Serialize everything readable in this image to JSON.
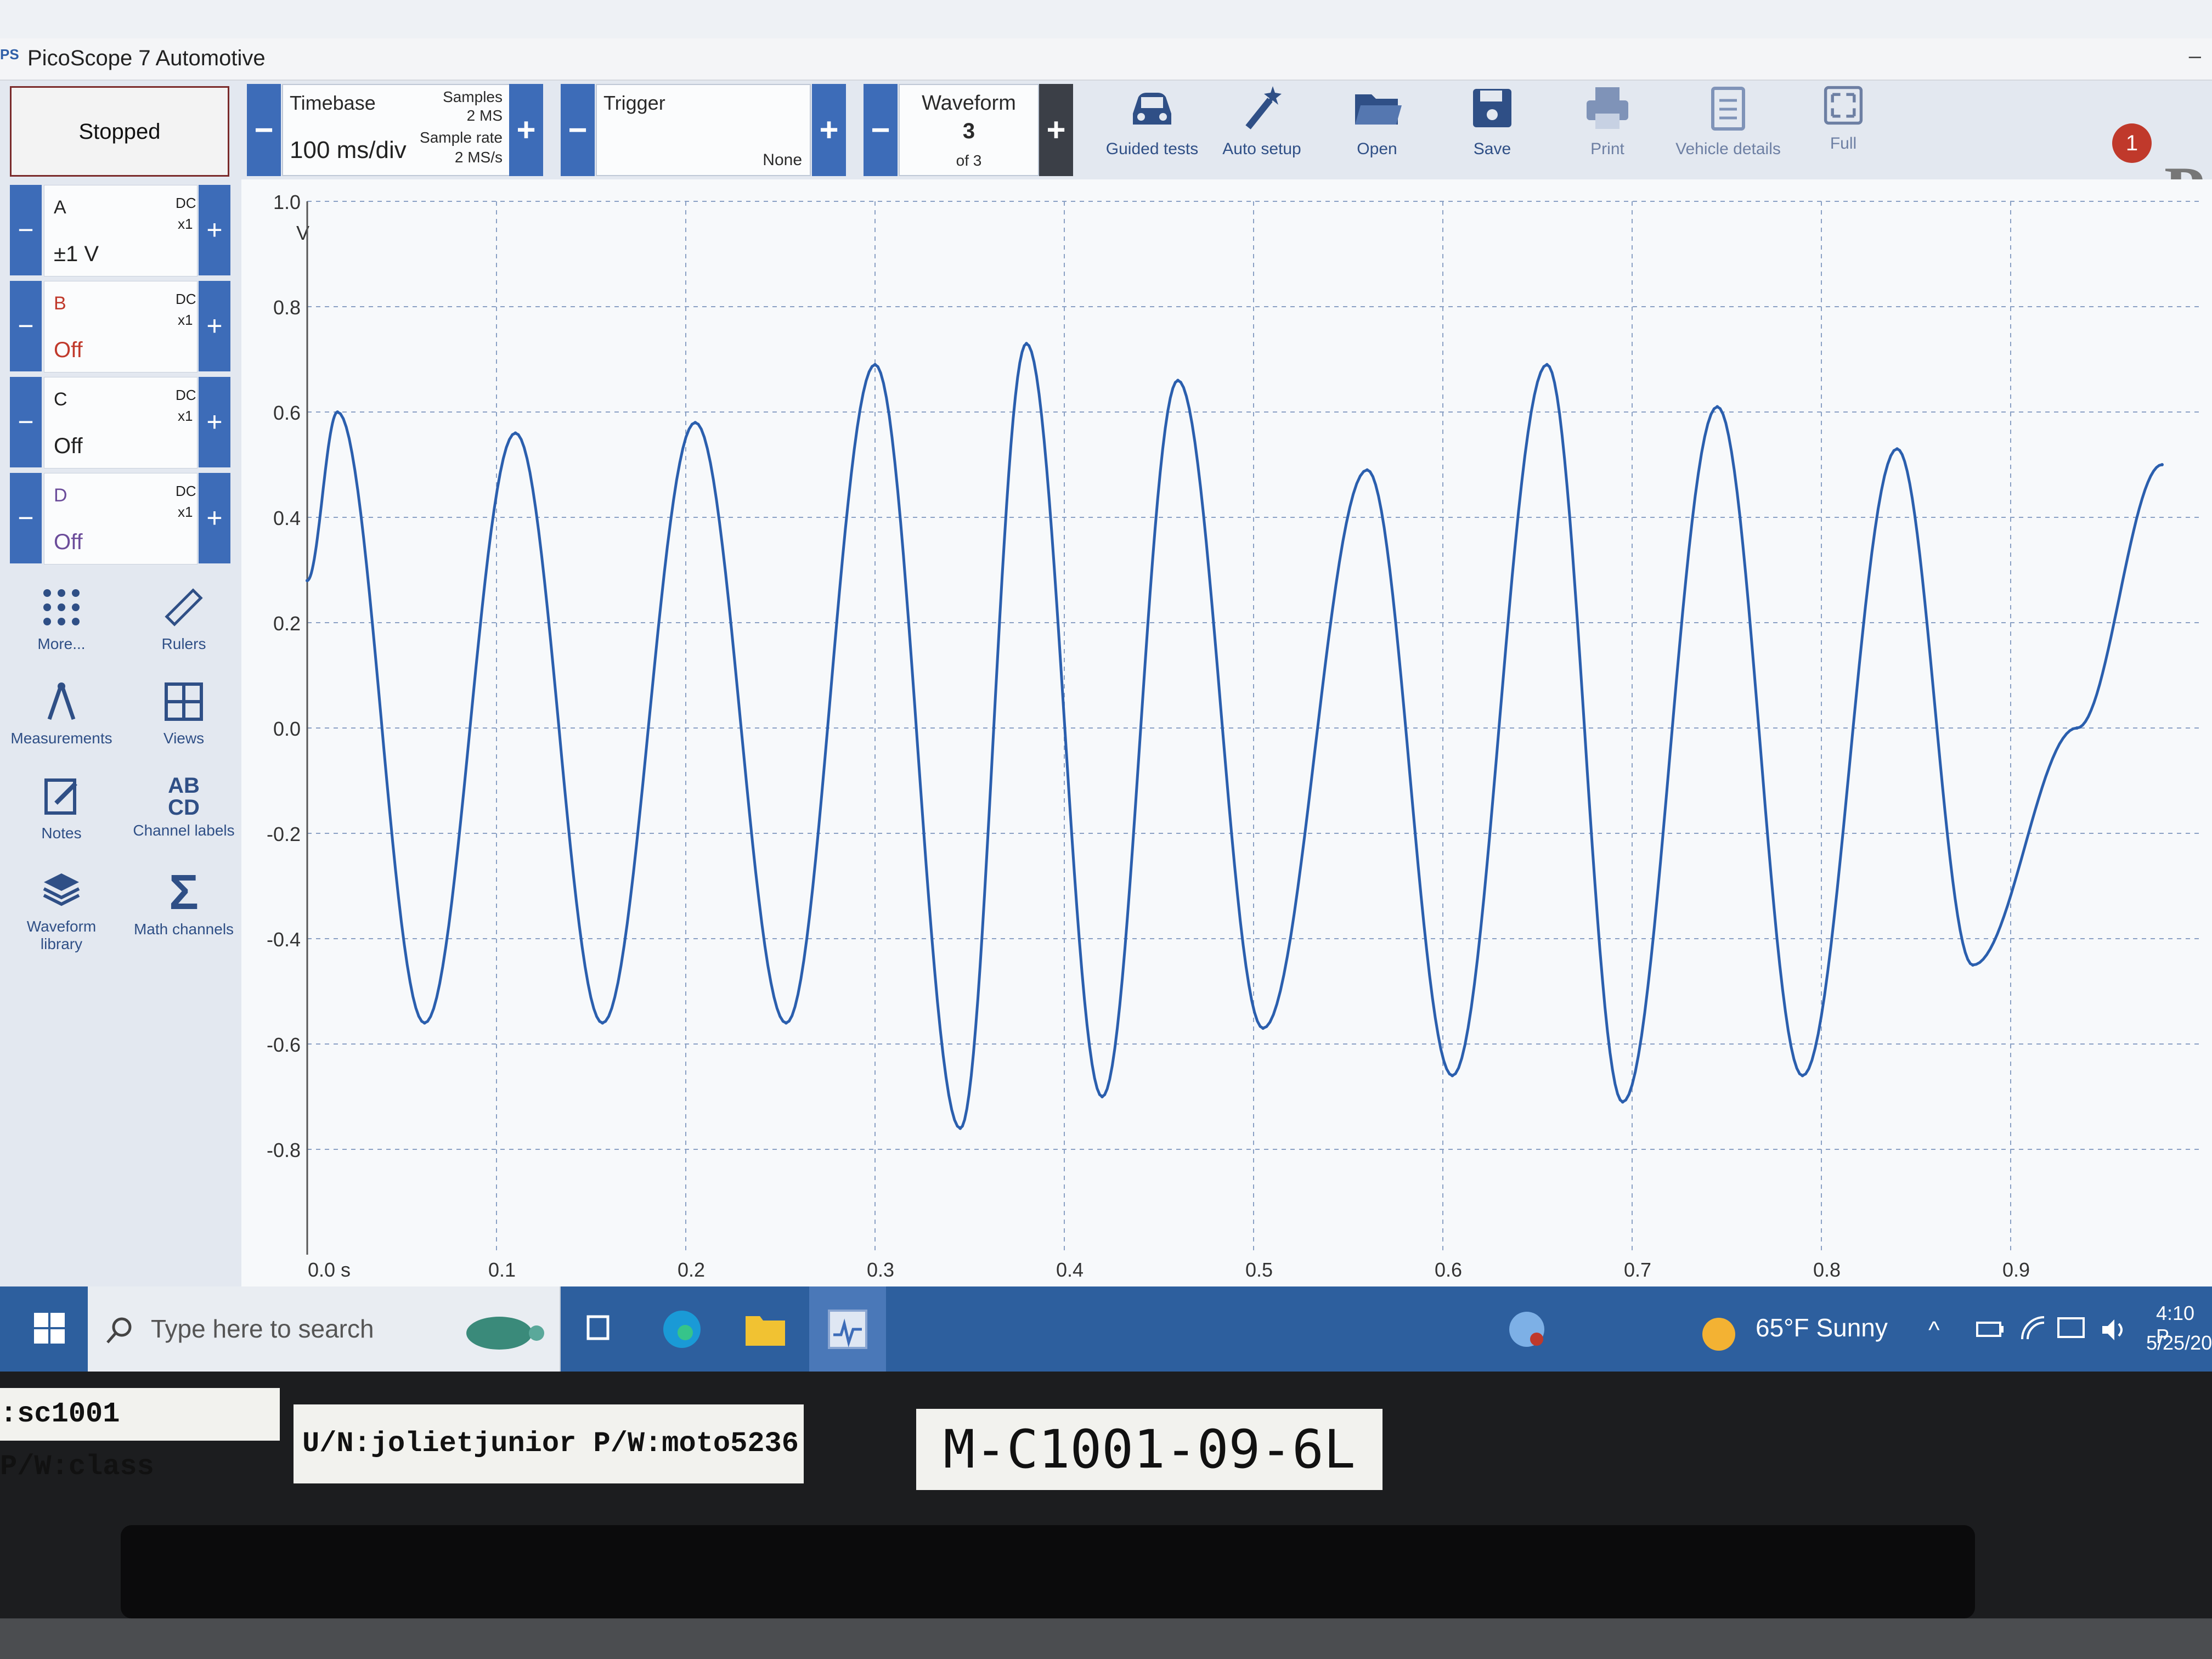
{
  "window": {
    "title": "PicoScope 7 Automotive",
    "app_icon": "PS"
  },
  "toolbar": {
    "stopped_label": "Stopped",
    "timebase": {
      "label": "Timebase",
      "value": "100 ms/div",
      "samples_label": "Samples",
      "samples_value": "2 MS",
      "rate_label": "Sample rate",
      "rate_value": "2 MS/s"
    },
    "trigger": {
      "label": "Trigger",
      "value": "None"
    },
    "waveform": {
      "label": "Waveform",
      "current": "3",
      "of": "of 3"
    },
    "tools": [
      "Guided tests",
      "Auto setup",
      "Open",
      "Save",
      "Print",
      "Vehicle details",
      "Full"
    ],
    "alert_count": "1",
    "minus": "−",
    "plus": "+"
  },
  "channels": [
    {
      "name": "A",
      "state": "±1 V",
      "coupling": "DC",
      "probe": "x1",
      "active": true
    },
    {
      "name": "B",
      "state": "Off",
      "coupling": "DC",
      "probe": "x1",
      "active": false
    },
    {
      "name": "C",
      "state": "Off",
      "coupling": "DC",
      "probe": "x1",
      "active": false
    },
    {
      "name": "D",
      "state": "Off",
      "coupling": "DC",
      "probe": "x1",
      "active": false
    }
  ],
  "side_tools": [
    "More...",
    "Rulers",
    "Measurements",
    "Views",
    "Notes",
    "Channel labels",
    "Waveform library",
    "Math channels"
  ],
  "channel_labels_icon_text": "AB CD",
  "chart_data": {
    "type": "line",
    "ylabel": "V",
    "ylim": [
      -1.0,
      1.0
    ],
    "y_ticks": [
      "1.0",
      "0.8",
      "0.6",
      "0.4",
      "0.2",
      "0.0",
      "-0.2",
      "-0.4",
      "-0.6",
      "-0.8"
    ],
    "x_ticks": [
      "0.0 s",
      "0.1",
      "0.2",
      "0.3",
      "0.4",
      "0.5",
      "0.6",
      "0.7",
      "0.8",
      "0.9"
    ],
    "xlim": [
      0,
      1.0
    ],
    "grid": true,
    "series": [
      {
        "color": "#2b5fae",
        "x": [
          0,
          0.016,
          0.062,
          0.11,
          0.156,
          0.205,
          0.253,
          0.3,
          0.345,
          0.38,
          0.42,
          0.46,
          0.505,
          0.56,
          0.605,
          0.655,
          0.695,
          0.745,
          0.79,
          0.84,
          0.88,
          0.935,
          0.98
        ],
        "y": [
          0.28,
          0.6,
          -0.56,
          0.56,
          -0.56,
          0.58,
          -0.56,
          0.69,
          -0.76,
          0.73,
          -0.7,
          0.66,
          -0.57,
          0.49,
          -0.66,
          0.69,
          -0.71,
          0.61,
          -0.66,
          0.53,
          -0.45,
          0.0,
          0.5
        ]
      }
    ]
  },
  "taskbar": {
    "search_placeholder": "Type here to search",
    "weather": "65°F  Sunny",
    "time": "4:10 P",
    "date": "5/25/20"
  },
  "stickers": [
    ":sc1001 P/W:class",
    "U/N:jolietjunior P/W:moto5236",
    "M-C1001-09-6L"
  ]
}
